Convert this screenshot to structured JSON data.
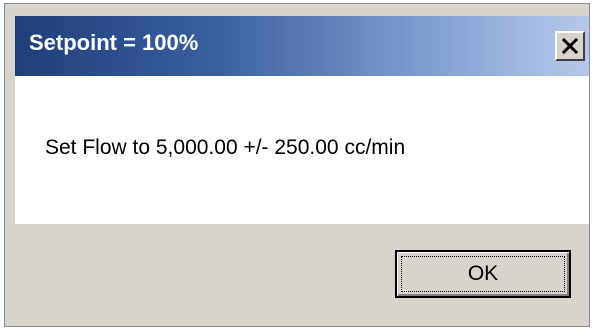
{
  "dialog": {
    "title": "Setpoint = 100%",
    "close_icon": "close-icon",
    "message": "Set Flow to 5,000.00 +/- 250.00 cc/min",
    "ok_label": "OK"
  }
}
